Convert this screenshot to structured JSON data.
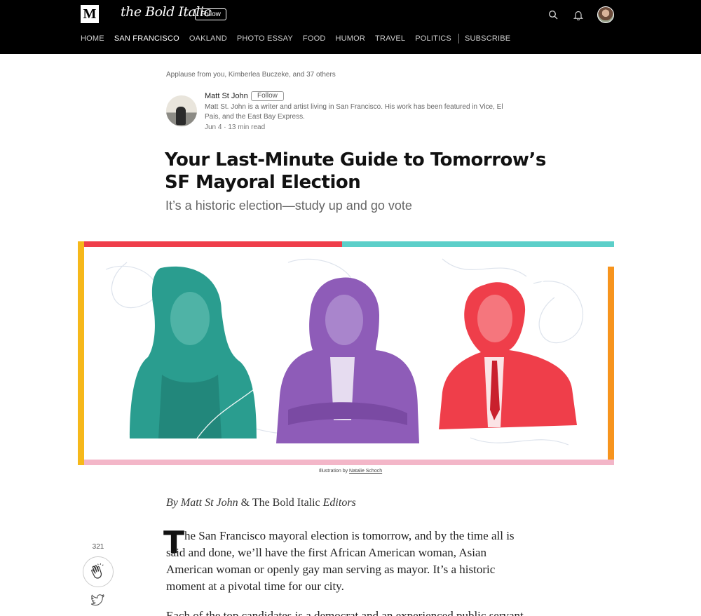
{
  "topbar": {
    "medium_logo": "M",
    "publication": "the Bold Italic",
    "follow_label": "Follow",
    "icons": [
      "search-icon",
      "bell-icon",
      "user-avatar"
    ]
  },
  "nav": {
    "items": [
      "HOME",
      "SAN FRANCISCO",
      "OAKLAND",
      "PHOTO ESSAY",
      "FOOD",
      "HUMOR",
      "TRAVEL",
      "POLITICS"
    ],
    "active": "SAN FRANCISCO",
    "subscribe": "SUBSCRIBE"
  },
  "article": {
    "applause": "Applause from you, Kimberlea Buczeke, and 37 others",
    "author": {
      "name": "Matt St John",
      "follow_label": "Follow",
      "bio": "Matt St. John is a writer and artist living in San Francisco. His work has been featured in Vice, El Pais, and the East Bay Express.",
      "meta": "Jun 4 · 13 min read"
    },
    "title": "Your Last-Minute Guide to Tomorrow’s SF Mayoral Election",
    "subtitle": "It’s a historic election—study up and go vote",
    "caption_prefix": "Illustration by ",
    "caption_credit": "Natalie Schoch",
    "byline_by": "By Matt St John",
    "byline_amp": " & The Bold Italic ",
    "byline_editors": "Editors",
    "dropcap": "T",
    "paragraph1": "he San Francisco mayoral election is tomorrow, and by the time all is said and done, we’ll have the first African American woman, Asian American woman or openly gay man serving as mayor. It’s a historic moment at a pivotal time for our city.",
    "paragraph2": "Each of the top candidates is a democrat and an experienced public servant,"
  },
  "rail": {
    "clap_count": "321",
    "icons": [
      "clap-icon",
      "twitter-icon"
    ]
  },
  "colors": {
    "topbar_bg": "#000000",
    "teal": "#2a9d8f",
    "purple": "#8e5cb8",
    "red": "#ef3e4a",
    "yellow": "#f6b81a",
    "pink": "#f3b6c8"
  }
}
